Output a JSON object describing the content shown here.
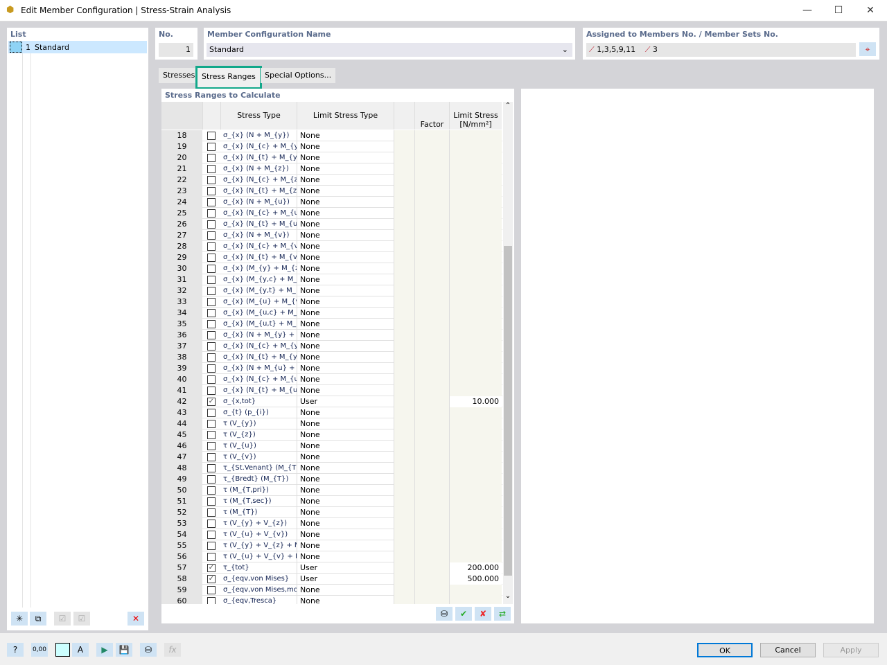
{
  "window": {
    "title": "Edit Member Configuration | Stress-Strain Analysis",
    "minimize": "—",
    "maximize": "☐",
    "close": "✕"
  },
  "list": {
    "label": "List",
    "items": [
      {
        "no": "1",
        "name": "Standard"
      }
    ]
  },
  "no": {
    "label": "No.",
    "value": "1"
  },
  "config": {
    "label": "Member Configuration Name",
    "value": "Standard"
  },
  "assigned": {
    "label": "Assigned to Members No. / Member Sets No.",
    "members": "1,3,5,9,11",
    "member_sets": "3"
  },
  "tabs": [
    {
      "label": "Stresses"
    },
    {
      "label": "Stress Ranges",
      "active": true
    },
    {
      "label": "Special Options..."
    }
  ],
  "section_title": "Stress Ranges to Calculate",
  "columns": {
    "stress_type": "Stress Type",
    "limit_type": "Limit Stress Type",
    "factor": "Factor",
    "limit_stress": "Limit Stress",
    "limit_unit": "[N/mm²]"
  },
  "rows": [
    {
      "no": "18",
      "c": false,
      "s": "σ_{x} (N + M_{y})",
      "t": "None",
      "v": ""
    },
    {
      "no": "19",
      "c": false,
      "s": "σ_{x} (N_{c} + M_{y,c})",
      "t": "None",
      "v": ""
    },
    {
      "no": "20",
      "c": false,
      "s": "σ_{x} (N_{t} + M_{y,t})",
      "t": "None",
      "v": ""
    },
    {
      "no": "21",
      "c": false,
      "s": "σ_{x} (N + M_{z})",
      "t": "None",
      "v": ""
    },
    {
      "no": "22",
      "c": false,
      "s": "σ_{x} (N_{c} + M_{z,c})",
      "t": "None",
      "v": ""
    },
    {
      "no": "23",
      "c": false,
      "s": "σ_{x} (N_{t} + M_{z,t})",
      "t": "None",
      "v": ""
    },
    {
      "no": "24",
      "c": false,
      "s": "σ_{x} (N + M_{u})",
      "t": "None",
      "v": ""
    },
    {
      "no": "25",
      "c": false,
      "s": "σ_{x} (N_{c} + M_{u,c})",
      "t": "None",
      "v": ""
    },
    {
      "no": "26",
      "c": false,
      "s": "σ_{x} (N_{t} + M_{u,t})",
      "t": "None",
      "v": ""
    },
    {
      "no": "27",
      "c": false,
      "s": "σ_{x} (N + M_{v})",
      "t": "None",
      "v": ""
    },
    {
      "no": "28",
      "c": false,
      "s": "σ_{x} (N_{c} + M_{v,c})",
      "t": "None",
      "v": ""
    },
    {
      "no": "29",
      "c": false,
      "s": "σ_{x} (N_{t} + M_{v,t})",
      "t": "None",
      "v": ""
    },
    {
      "no": "30",
      "c": false,
      "s": "σ_{x} (M_{y} + M_{z})",
      "t": "None",
      "v": ""
    },
    {
      "no": "31",
      "c": false,
      "s": "σ_{x} (M_{y,c} + M_{z,c})",
      "t": "None",
      "v": ""
    },
    {
      "no": "32",
      "c": false,
      "s": "σ_{x} (M_{y,t} + M_{z,t})",
      "t": "None",
      "v": ""
    },
    {
      "no": "33",
      "c": false,
      "s": "σ_{x} (M_{u} + M_{v})",
      "t": "None",
      "v": ""
    },
    {
      "no": "34",
      "c": false,
      "s": "σ_{x} (M_{u,c} + M_{v,c})",
      "t": "None",
      "v": ""
    },
    {
      "no": "35",
      "c": false,
      "s": "σ_{x} (M_{u,t} + M_{v,t})",
      "t": "None",
      "v": ""
    },
    {
      "no": "36",
      "c": false,
      "s": "σ_{x} (N + M_{y} + M_{z})",
      "t": "None",
      "v": ""
    },
    {
      "no": "37",
      "c": false,
      "s": "σ_{x} (N_{c} + M_{y,c} + M_{z,c})",
      "t": "None",
      "v": ""
    },
    {
      "no": "38",
      "c": false,
      "s": "σ_{x} (N_{t} + M_{y,t} + M_{z,t})",
      "t": "None",
      "v": ""
    },
    {
      "no": "39",
      "c": false,
      "s": "σ_{x} (N + M_{u} + M_{v})",
      "t": "None",
      "v": ""
    },
    {
      "no": "40",
      "c": false,
      "s": "σ_{x} (N_{c} + M_{u,c} + M_{v,c})",
      "t": "None",
      "v": ""
    },
    {
      "no": "41",
      "c": false,
      "s": "σ_{x} (N_{t} + M_{u,t} + M_{v,t})",
      "t": "None",
      "v": ""
    },
    {
      "no": "42",
      "c": true,
      "s": "σ_{x,tot}",
      "t": "User",
      "v": "10.000"
    },
    {
      "no": "43",
      "c": false,
      "s": "σ_{t} (p_{i})",
      "t": "None",
      "v": ""
    },
    {
      "no": "44",
      "c": false,
      "s": "τ (V_{y})",
      "t": "None",
      "v": ""
    },
    {
      "no": "45",
      "c": false,
      "s": "τ (V_{z})",
      "t": "None",
      "v": ""
    },
    {
      "no": "46",
      "c": false,
      "s": "τ (V_{u})",
      "t": "None",
      "v": ""
    },
    {
      "no": "47",
      "c": false,
      "s": "τ (V_{v})",
      "t": "None",
      "v": ""
    },
    {
      "no": "48",
      "c": false,
      "s": "τ_{St.Venant} (M_{T})",
      "t": "None",
      "v": ""
    },
    {
      "no": "49",
      "c": false,
      "s": "τ_{Bredt} (M_{T})",
      "t": "None",
      "v": ""
    },
    {
      "no": "50",
      "c": false,
      "s": "τ (M_{T,pri})",
      "t": "None",
      "v": ""
    },
    {
      "no": "51",
      "c": false,
      "s": "τ (M_{T,sec})",
      "t": "None",
      "v": ""
    },
    {
      "no": "52",
      "c": false,
      "s": "τ (M_{T})",
      "t": "None",
      "v": ""
    },
    {
      "no": "53",
      "c": false,
      "s": "τ (V_{y} + V_{z})",
      "t": "None",
      "v": ""
    },
    {
      "no": "54",
      "c": false,
      "s": "τ (V_{u} + V_{v})",
      "t": "None",
      "v": ""
    },
    {
      "no": "55",
      "c": false,
      "s": "τ (V_{y} + V_{z} + M_{T})",
      "t": "None",
      "v": ""
    },
    {
      "no": "56",
      "c": false,
      "s": "τ (V_{u} + V_{v} + M_{T})",
      "t": "None",
      "v": ""
    },
    {
      "no": "57",
      "c": true,
      "s": "τ_{tot}",
      "t": "User",
      "v": "200.000"
    },
    {
      "no": "58",
      "c": true,
      "s": "σ_{eqv,von Mises}",
      "t": "User",
      "v": "500.000"
    },
    {
      "no": "59",
      "c": false,
      "s": "σ_{eqv,von Mises,mod}",
      "t": "None",
      "v": ""
    },
    {
      "no": "60",
      "c": false,
      "s": "σ_{eqv,Tresca}",
      "t": "None",
      "v": ""
    }
  ],
  "scrollbar": {
    "position_fraction": 0.5
  },
  "buttons": {
    "ok": "OK",
    "cancel": "Cancel",
    "apply": "Apply"
  },
  "colors": {
    "accent_tab_border": "#12a88a",
    "label": "#5a6b8c",
    "selected": "#cce8ff"
  }
}
